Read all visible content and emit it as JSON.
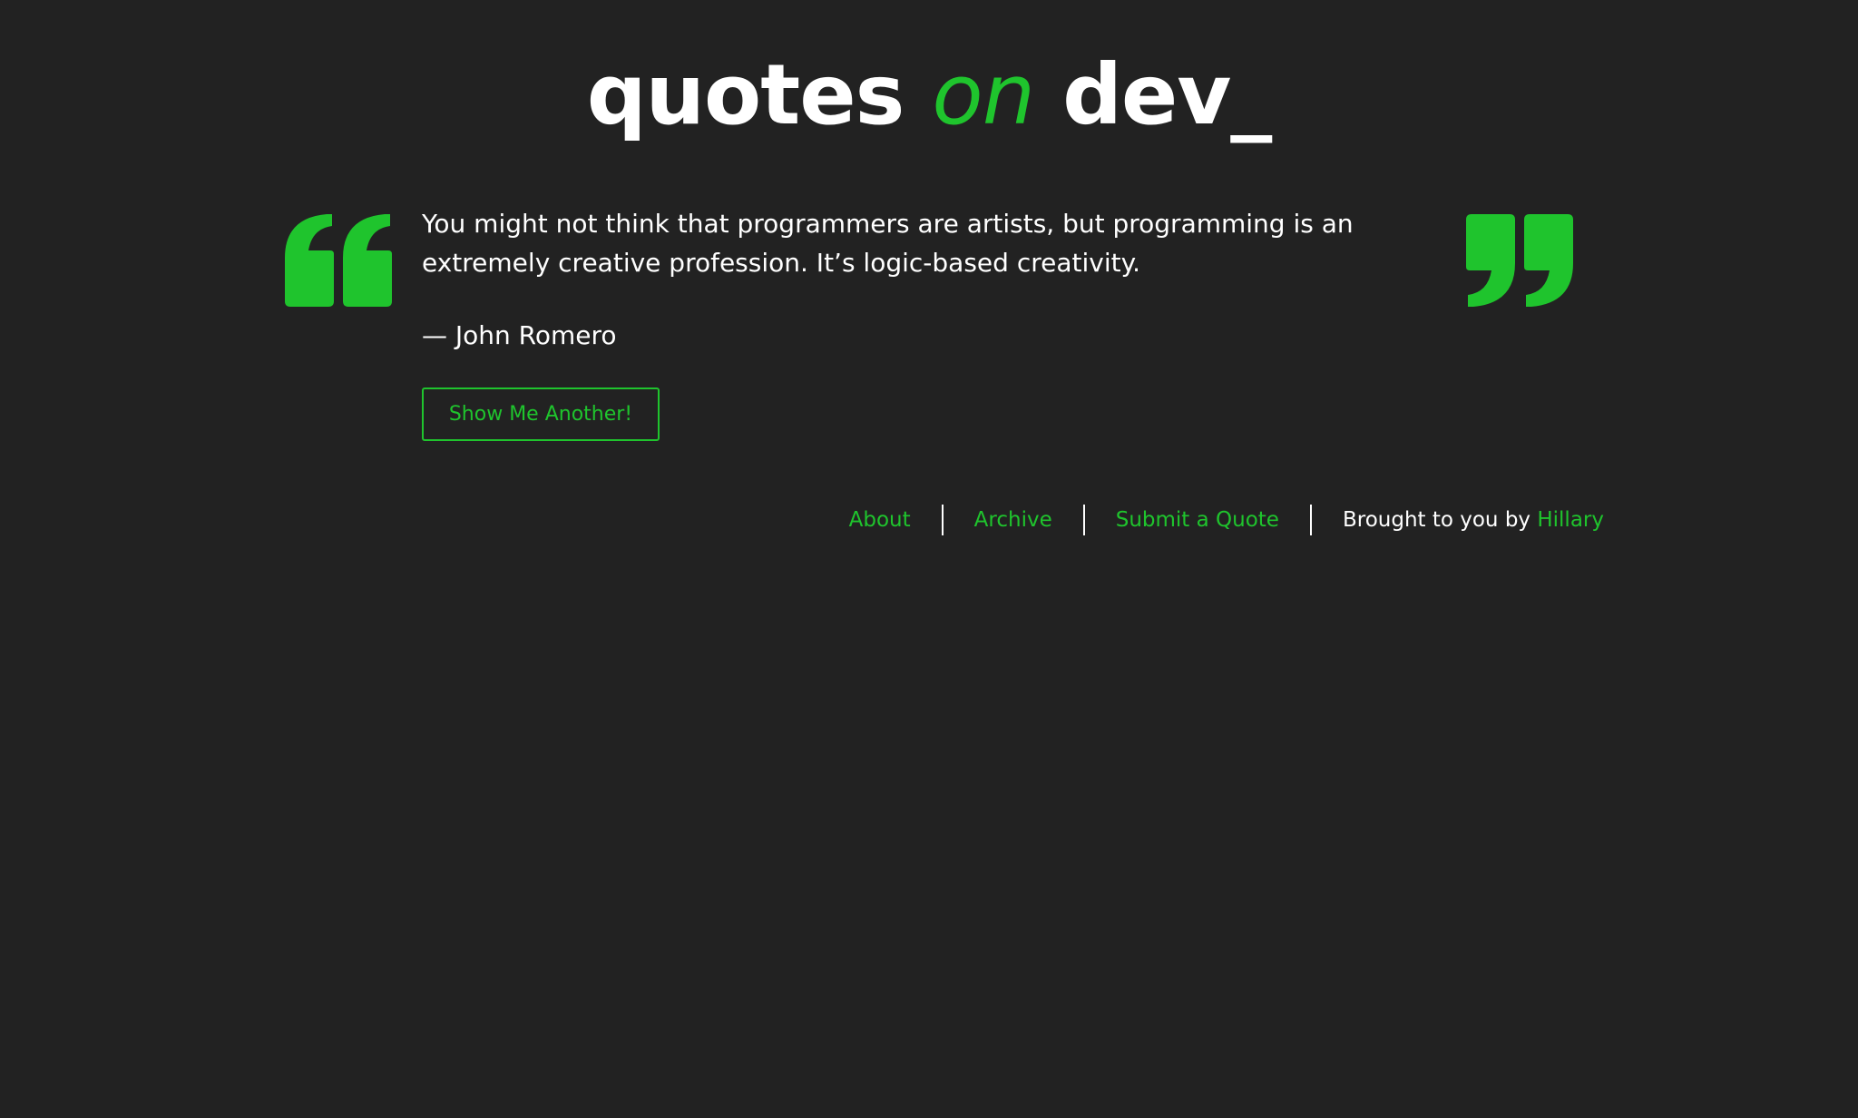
{
  "header": {
    "title_part1": "quotes",
    "title_part2": "on",
    "title_part3": "dev_"
  },
  "quote": {
    "text": "You might not think that programmers are artists, but programming is an extremely creative profession. It’s logic-based creativity.",
    "author": "— John Romero"
  },
  "actions": {
    "another_label": "Show Me Another!"
  },
  "footer": {
    "about_label": "About",
    "archive_label": "Archive",
    "submit_label": "Submit a Quote",
    "credit_prefix": "Brought to you by",
    "credit_name": "Hillary"
  },
  "colors": {
    "background": "#222222",
    "accent": "#1fc42d",
    "text": "#ffffff"
  },
  "icons": {
    "open_quote": "open-quote-icon",
    "close_quote": "close-quote-icon"
  }
}
